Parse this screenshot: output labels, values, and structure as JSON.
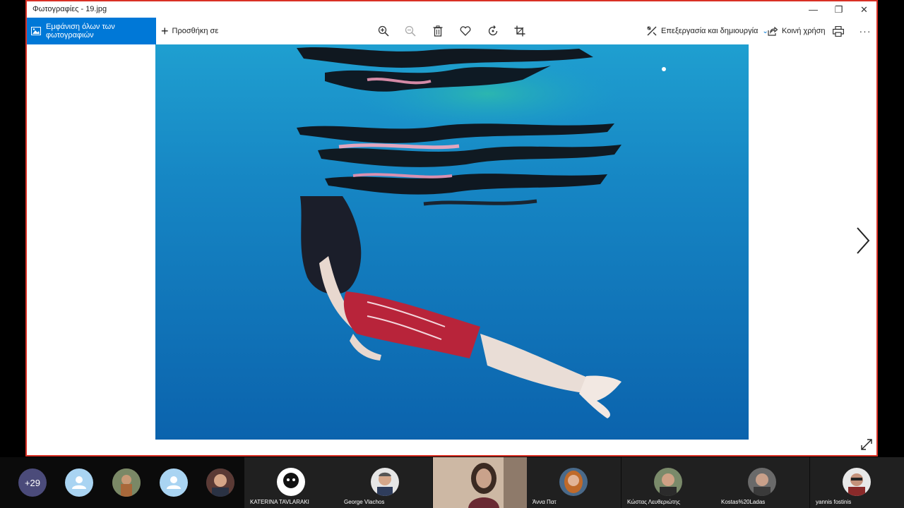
{
  "window": {
    "title": "Φωτογραφίες - 19.jpg",
    "controls": {
      "minimize": "—",
      "maximize": "❐",
      "close": "✕"
    }
  },
  "toolbar": {
    "all_photos_label": "Εμφάνιση όλων των φωτογραφιών",
    "add_to_label": "Προσθήκη σε",
    "edit_create_label": "Επεξεργασία και δημιουργία",
    "share_label": "Κοινή χρήση",
    "icons": [
      "zoom-in-icon",
      "zoom-out-icon",
      "delete-icon",
      "heart-icon",
      "rotate-icon",
      "crop-icon",
      "print-icon",
      "more-icon"
    ],
    "accent": "#0078d7"
  },
  "meeting": {
    "more_count": "+29",
    "participants": [
      {
        "name": "KATERINA TAVLARAKI"
      },
      {
        "name": "George Vlachos"
      },
      {
        "name": ""
      },
      {
        "name": "Άννα Πατ"
      },
      {
        "name": "Κώστας Λευθεριώτης"
      },
      {
        "name": "Kostas%20Ladas"
      },
      {
        "name": "yannis fostinis"
      }
    ],
    "share_border_color": "#d93025"
  }
}
